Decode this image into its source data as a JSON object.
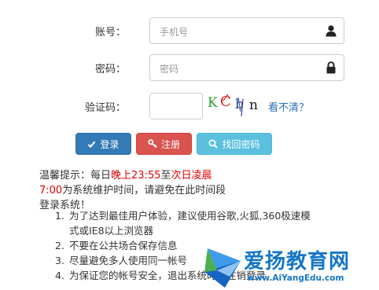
{
  "form": {
    "account": {
      "label": "账号：",
      "placeholder": "手机号",
      "icon": "user-icon"
    },
    "password": {
      "label": "密码：",
      "placeholder": "密码",
      "icon": "lock-icon"
    },
    "captcha": {
      "label": "验证码：",
      "refresh_link": "看不清？"
    }
  },
  "buttons": {
    "login": "登录",
    "register": "注册",
    "forgot": "找回密码"
  },
  "notice": {
    "prefix": "温馨提示：每日",
    "start": "晚上23:55",
    "middle": "至",
    "end": "次日凌晨7:00",
    "suffix": "为系统维护时间，请避免在此时间段登录系统！"
  },
  "tips": [
    "为了达到最佳用户体验，建议使用谷歌,火狐,360极速模式或IE8以上浏览器",
    "不要在公共场合保存信息",
    "尽量避免多人使用同一帐号",
    "为保证您的帐号安全，退出系统时请注销登录"
  ],
  "watermark": {
    "title": "爱扬教育网",
    "url": "www.AiYangEdu.com"
  },
  "colors": {
    "primary": "#337ab7",
    "danger": "#d9534f",
    "info": "#5bc0de",
    "alert_red": "#e60000",
    "link": "#2a6fb5"
  }
}
